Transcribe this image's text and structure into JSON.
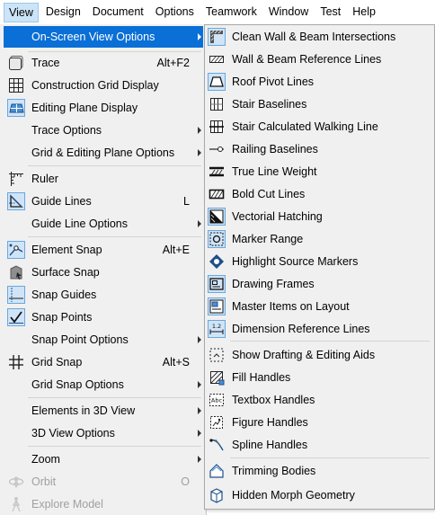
{
  "menubar": {
    "items": [
      "View",
      "Design",
      "Document",
      "Options",
      "Teamwork",
      "Window",
      "Test",
      "Help"
    ]
  },
  "view_menu": {
    "items": {
      "onscreen": {
        "label": "On-Screen View Options"
      },
      "trace": {
        "label": "Trace",
        "shortcut": "Alt+F2",
        "icon": "trace-icon"
      },
      "construction_grid": {
        "label": "Construction Grid Display",
        "icon": "grid-icon"
      },
      "editing_plane": {
        "label": "Editing Plane Display",
        "icon": "editing-plane-icon"
      },
      "trace_options": {
        "label": "Trace Options"
      },
      "grid_plane_options": {
        "label": "Grid & Editing Plane Options"
      },
      "ruler": {
        "label": "Ruler",
        "icon": "ruler-icon"
      },
      "guide_lines": {
        "label": "Guide Lines",
        "shortcut": "L",
        "icon": "guide-lines-icon"
      },
      "guide_line_options": {
        "label": "Guide Line Options"
      },
      "element_snap": {
        "label": "Element Snap",
        "shortcut": "Alt+E",
        "icon": "element-snap-icon"
      },
      "surface_snap": {
        "label": "Surface Snap",
        "icon": "surface-snap-icon"
      },
      "snap_guides": {
        "label": "Snap Guides",
        "icon": "snap-guides-icon"
      },
      "snap_points": {
        "label": "Snap Points",
        "icon": "snap-points-icon"
      },
      "snap_point_options": {
        "label": "Snap Point Options"
      },
      "grid_snap": {
        "label": "Grid Snap",
        "shortcut": "Alt+S",
        "icon": "grid-snap-icon"
      },
      "grid_snap_options": {
        "label": "Grid Snap Options"
      },
      "elements_3d": {
        "label": "Elements in 3D View"
      },
      "options_3d": {
        "label": "3D View Options"
      },
      "zoom": {
        "label": "Zoom"
      },
      "orbit": {
        "label": "Orbit",
        "shortcut": "O",
        "icon": "orbit-icon"
      },
      "explore": {
        "label": "Explore Model",
        "icon": "explore-model-icon"
      }
    }
  },
  "submenu": {
    "items": [
      {
        "label": "Clean Wall & Beam Intersections",
        "icon": "clean-intersections-icon"
      },
      {
        "label": "Wall & Beam Reference Lines",
        "icon": "reference-lines-icon"
      },
      {
        "label": "Roof Pivot Lines",
        "icon": "roof-pivot-icon"
      },
      {
        "label": "Stair Baselines",
        "icon": "stair-baselines-icon"
      },
      {
        "label": "Stair Calculated Walking Line",
        "icon": "stair-walking-line-icon"
      },
      {
        "label": "Railing Baselines",
        "icon": "railing-baselines-icon"
      },
      {
        "label": "True Line Weight",
        "icon": "line-weight-icon"
      },
      {
        "label": "Bold Cut Lines",
        "icon": "bold-cut-lines-icon"
      },
      {
        "label": "Vectorial Hatching",
        "icon": "vectorial-hatching-icon"
      },
      {
        "label": "Marker Range",
        "icon": "marker-range-icon"
      },
      {
        "label": "Highlight Source Markers",
        "icon": "highlight-markers-icon"
      },
      {
        "label": "Drawing Frames",
        "icon": "drawing-frames-icon"
      },
      {
        "label": "Master Items on Layout",
        "icon": "master-items-icon"
      },
      {
        "label": "Dimension Reference Lines",
        "icon": "dimension-reference-icon"
      },
      {
        "label": "Show Drafting & Editing Aids",
        "icon": "drafting-aids-icon"
      },
      {
        "label": "Fill Handles",
        "icon": "fill-handles-icon"
      },
      {
        "label": "Textbox Handles",
        "icon": "textbox-handles-icon",
        "icon_text": "Abc"
      },
      {
        "label": "Figure Handles",
        "icon": "figure-handles-icon"
      },
      {
        "label": "Spline Handles",
        "icon": "spline-handles-icon"
      },
      {
        "label": "Trimming Bodies",
        "icon": "trimming-bodies-icon"
      },
      {
        "label": "Hidden Morph Geometry",
        "icon": "hidden-morph-icon"
      }
    ],
    "dimension_icon_text": "1.2"
  },
  "colors": {
    "highlight": "#0a6fd6",
    "menubar_active": "#cce4f7",
    "icon_box": "#cfe4f7",
    "icon_border": "#6aa7dc",
    "disabled_text": "#a0a0a0"
  }
}
